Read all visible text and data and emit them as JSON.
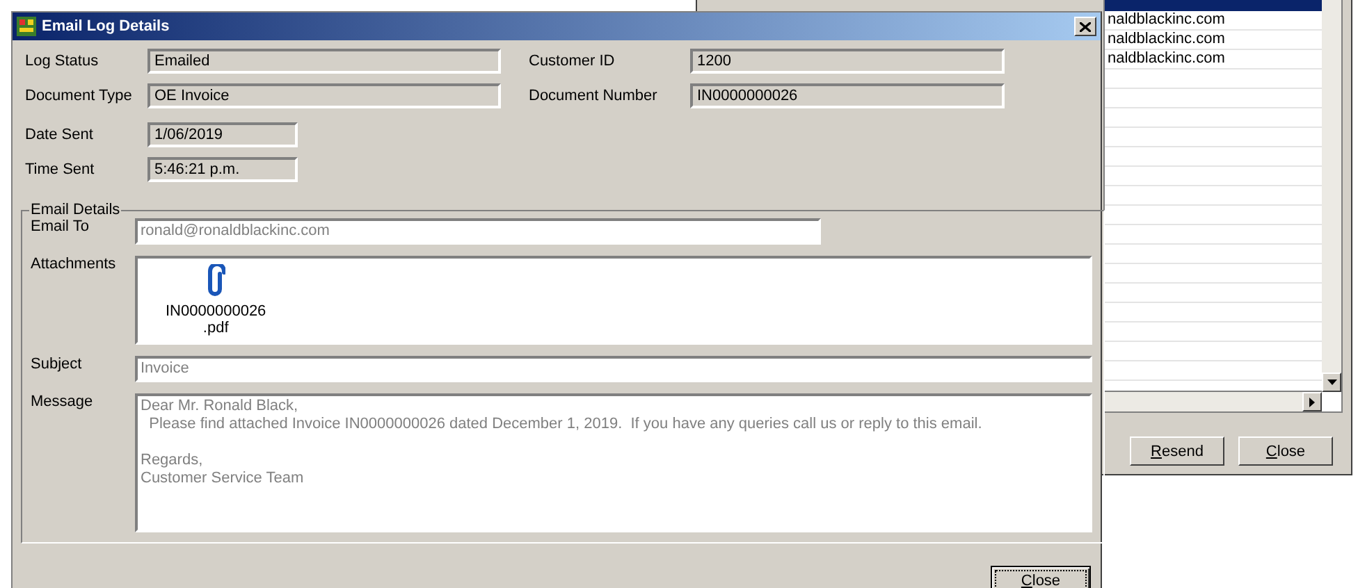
{
  "log_window": {
    "rows": [
      {
        "text": "naldblackinc.com"
      },
      {
        "text": "naldblackinc.com"
      },
      {
        "text": "naldblackinc.com"
      }
    ],
    "buttons": [
      "Resend",
      "Close"
    ]
  },
  "dialog": {
    "title": "Email Log Details",
    "summary": [
      {
        "label": "Log Status",
        "value": "Emailed"
      },
      {
        "label": "Customer ID",
        "value": "1200"
      },
      {
        "label": "Document Type",
        "value": "OE Invoice"
      },
      {
        "label": "Document Number",
        "value": "IN0000000026"
      }
    ],
    "sent": [
      {
        "label": "Date Sent",
        "value": "1/06/2019"
      },
      {
        "label": "Time Sent",
        "value": "5:46:21 p.m."
      }
    ],
    "email_details": {
      "title": "Email Details",
      "email_to": {
        "label": "Email To",
        "value": "ronald@ronaldblackinc.com"
      },
      "attachments": {
        "label": "Attachments",
        "files": [
          {
            "name": "IN0000000026\n.pdf"
          }
        ]
      },
      "subject": {
        "label": "Subject",
        "value": "Invoice"
      },
      "message": {
        "label": "Message",
        "value": "Dear Mr. Ronald Black,\n  Please find attached Invoice IN0000000026 dated December 1, 2019.  If you have any queries call us or reply to this email.\n\nRegards,\nCustomer Service Team"
      }
    },
    "button": "Close"
  }
}
